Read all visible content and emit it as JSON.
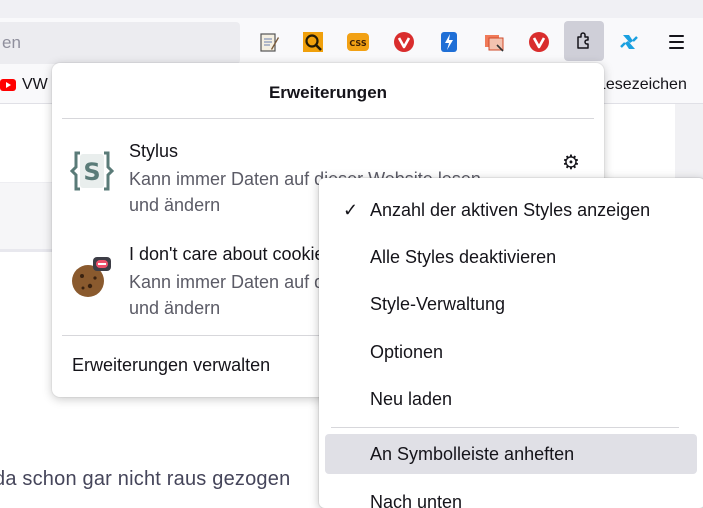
{
  "urlbar": {
    "placeholder": "en"
  },
  "toolbar": {
    "extension_icons": [
      "notepad-icon",
      "magnifier-icon",
      "css-icon",
      "vivaldi-v-icon",
      "lightning-icon",
      "screenshot-icon",
      "vivaldi-v-icon",
      "puzzle-icon",
      "sync-arrows-icon"
    ],
    "menu_icon": "hamburger-icon"
  },
  "bookmarks": {
    "items": [
      {
        "icon": "youtube-icon",
        "label": "VW"
      },
      {
        "label": "Lesezeichen"
      }
    ]
  },
  "page": {
    "text": "da schon gar nicht raus gezogen"
  },
  "panel": {
    "title": "Erweiterungen",
    "extensions": [
      {
        "name": "Stylus",
        "description": "Kann immer Daten auf dieser Website lesen und ändern",
        "icon": "stylus-s-icon"
      },
      {
        "name": "I don't care about cookies",
        "description": "Kann immer Daten auf dieser Website lesen und ändern",
        "icon": "cookie-icon"
      }
    ],
    "manage_label": "Erweiterungen verwalten"
  },
  "context_menu": {
    "items": [
      {
        "label": "Anzahl der aktiven Styles anzeigen",
        "checked": true
      },
      {
        "label": "Alle Styles deaktivieren"
      },
      {
        "label": "Style-Verwaltung"
      },
      {
        "label": "Optionen"
      },
      {
        "label": "Neu laden"
      },
      {
        "label": "An Symbolleiste anheften",
        "highlighted": true
      },
      {
        "label": "Nach unten"
      }
    ]
  },
  "colors": {
    "accent": "#cfcfd8",
    "vivaldi_red": "#ef3939",
    "youtube_red": "#ff0000"
  }
}
